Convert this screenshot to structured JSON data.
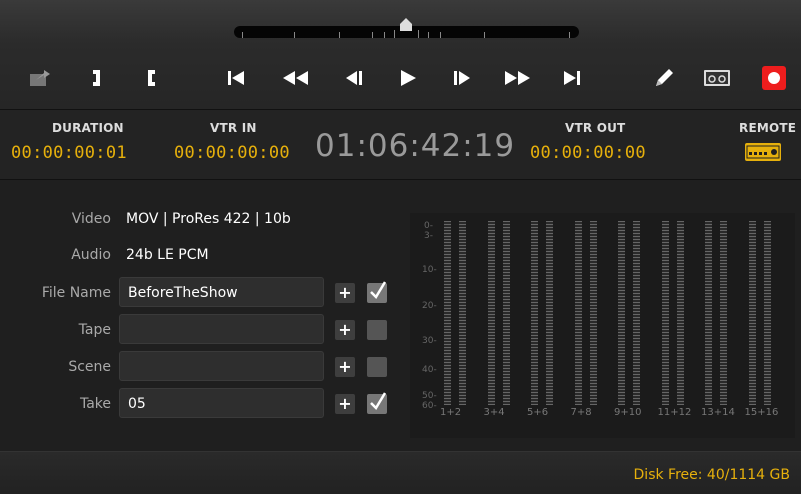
{
  "toolbar": {
    "buttons": [
      {
        "name": "export-icon"
      },
      {
        "name": "mark-out-icon"
      },
      {
        "name": "mark-in-icon"
      },
      {
        "name": "go-to-start-icon"
      },
      {
        "name": "rewind-icon"
      },
      {
        "name": "step-back-icon"
      },
      {
        "name": "play-icon"
      },
      {
        "name": "step-forward-icon"
      },
      {
        "name": "fast-forward-icon"
      },
      {
        "name": "go-to-end-icon"
      },
      {
        "name": "edit-pencil-icon"
      },
      {
        "name": "tape-icon"
      },
      {
        "name": "record-icon"
      }
    ],
    "colors": {
      "record": "#ee1d1d",
      "accent": "#e6b00c"
    }
  },
  "timecode": {
    "duration_label": "DURATION",
    "duration_value": "00:00:00:01",
    "vtr_in_label": "VTR IN",
    "vtr_in_value": "00:00:00:00",
    "current": "01:06:42:19",
    "vtr_out_label": "VTR OUT",
    "vtr_out_value": "00:00:00:00",
    "remote_label": "REMOTE"
  },
  "info": {
    "video_label": "Video",
    "video_value": "MOV | ProRes 422 | 10b",
    "audio_label": "Audio",
    "audio_value": "24b LE PCM"
  },
  "fields": [
    {
      "label": "File Name",
      "value": "BeforeTheShow",
      "checked": true
    },
    {
      "label": "Tape",
      "value": "",
      "checked": false
    },
    {
      "label": "Scene",
      "value": "",
      "checked": false
    },
    {
      "label": "Take",
      "value": "05",
      "checked": true
    }
  ],
  "plus_label": "+",
  "meters": {
    "scale": [
      "0-",
      "3-",
      "10-",
      "20-",
      "30-",
      "40-",
      "50-",
      "60-"
    ],
    "channels": [
      "1+2",
      "3+4",
      "5+6",
      "7+8",
      "9+10",
      "11+12",
      "13+14",
      "15+16"
    ]
  },
  "footer": {
    "disk_free": "Disk Free: 40/1114 GB"
  }
}
